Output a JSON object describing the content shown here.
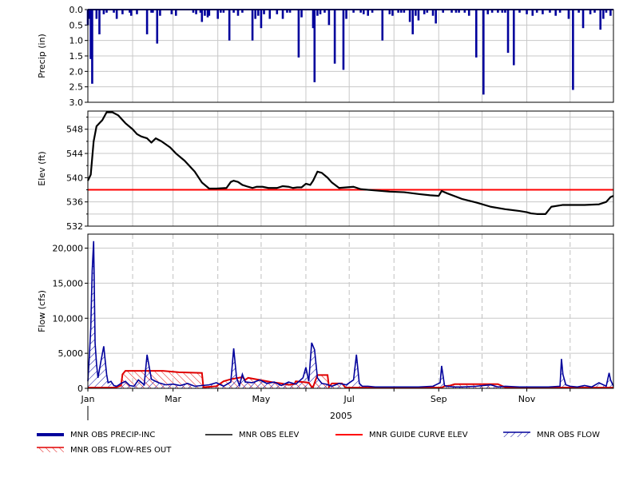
{
  "chart_data": [
    {
      "type": "bar",
      "panel": "precip",
      "ylabel": "Precip (in)",
      "ylim": [
        0,
        3.0
      ],
      "y_inverted": true,
      "yticks": [
        "0.0",
        "0.5",
        "1.0",
        "1.5",
        "2.0",
        "2.5",
        "3.0"
      ],
      "grid": true,
      "series": [
        {
          "name": "MNR OBS PRECIP-INC",
          "color": "#00009c",
          "x_day": [
            1,
            2,
            3,
            4,
            7,
            9,
            12,
            14,
            19,
            21,
            25,
            30,
            31,
            35,
            42,
            45,
            46,
            49,
            51,
            59,
            62,
            74,
            76,
            79,
            80,
            82,
            84,
            85,
            91,
            93,
            95,
            99,
            102,
            105,
            108,
            115,
            117,
            119,
            121,
            123,
            127,
            132,
            136,
            139,
            141,
            147,
            149,
            157,
            158,
            160,
            162,
            165,
            168,
            172,
            178,
            180,
            185,
            190,
            192,
            195,
            198,
            205,
            210,
            212,
            216,
            218,
            220,
            224,
            226,
            228,
            230,
            234,
            236,
            240,
            242,
            247,
            253,
            256,
            258,
            262,
            265,
            270,
            275,
            278,
            281,
            285,
            288,
            290,
            292,
            296,
            300,
            305,
            309,
            312,
            316,
            321,
            325,
            328,
            334,
            337,
            341,
            344,
            349,
            352,
            356,
            358,
            360,
            363
          ],
          "values": [
            0.5,
            0.3,
            1.6,
            2.4,
            0.3,
            0.8,
            0.15,
            0.1,
            0.1,
            0.3,
            0.15,
            0.1,
            0.2,
            0.15,
            0.8,
            0.1,
            0.1,
            1.1,
            0.2,
            0.15,
            0.2,
            0.1,
            0.15,
            0.1,
            0.4,
            0.2,
            0.25,
            0.2,
            0.3,
            0.1,
            0.1,
            1.0,
            0.1,
            0.2,
            0.1,
            1.0,
            0.3,
            0.2,
            0.6,
            0.15,
            0.3,
            0.15,
            0.3,
            0.1,
            0.1,
            1.55,
            0.25,
            0.6,
            2.35,
            0.2,
            0.15,
            0.1,
            0.5,
            1.75,
            1.95,
            0.3,
            0.1,
            0.1,
            0.15,
            0.2,
            0.1,
            1.0,
            0.15,
            0.2,
            0.1,
            0.1,
            0.1,
            0.4,
            0.8,
            0.2,
            0.35,
            0.15,
            0.1,
            0.2,
            0.45,
            0.1,
            0.1,
            0.1,
            0.1,
            0.1,
            0.2,
            1.55,
            2.75,
            0.15,
            0.1,
            0.1,
            0.1,
            0.1,
            1.4,
            1.8,
            0.1,
            0.15,
            0.2,
            0.1,
            0.15,
            0.1,
            0.2,
            0.1,
            0.3,
            2.6,
            0.1,
            0.6,
            0.15,
            0.1,
            0.65,
            0.3,
            0.1,
            0.2
          ]
        }
      ]
    },
    {
      "type": "line",
      "panel": "elev",
      "ylabel": "Elev (ft)",
      "ylim": [
        532,
        551
      ],
      "yticks": [
        "532",
        "536",
        "540",
        "544",
        "548"
      ],
      "grid": true,
      "series": [
        {
          "name": "MNR OBS ELEV",
          "color": "#000000",
          "x_day": [
            1,
            3,
            5,
            7,
            9,
            11,
            14,
            18,
            22,
            27,
            32,
            35,
            38,
            42,
            45,
            48,
            52,
            58,
            62,
            68,
            75,
            80,
            85,
            90,
            97,
            100,
            102,
            105,
            108,
            112,
            115,
            118,
            122,
            126,
            132,
            136,
            140,
            143,
            146,
            149,
            152,
            155,
            157,
            160,
            163,
            167,
            170,
            175,
            180,
            185,
            190,
            200,
            210,
            220,
            230,
            238,
            244,
            246,
            250,
            260,
            270,
            280,
            290,
            300,
            305,
            308,
            312,
            318,
            322,
            330,
            345,
            355,
            360,
            363,
            365
          ],
          "values": [
            539.5,
            540.5,
            546,
            548.5,
            549,
            549.5,
            550.8,
            550.8,
            550.3,
            549,
            548,
            547.2,
            546.8,
            546.5,
            545.8,
            546.5,
            546,
            545,
            544,
            542.8,
            541,
            539.2,
            538.2,
            538.2,
            538.3,
            539.3,
            539.5,
            539.3,
            538.8,
            538.5,
            538.3,
            538.5,
            538.5,
            538.3,
            538.3,
            538.6,
            538.5,
            538.3,
            538.4,
            538.4,
            539,
            538.8,
            539.5,
            541,
            540.8,
            540,
            539.2,
            538.3,
            538.4,
            538.5,
            538.1,
            537.9,
            537.7,
            537.6,
            537.3,
            537.1,
            537,
            537.8,
            537.4,
            536.5,
            535.9,
            535.2,
            534.8,
            534.5,
            534.3,
            534.1,
            534,
            534,
            535.2,
            535.5,
            535.5,
            535.6,
            536,
            536.8,
            537
          ]
        },
        {
          "name": "MNR GUIDE CURVE ELEV",
          "color": "#ff0000",
          "x_day": [
            1,
            365
          ],
          "values": [
            538,
            538
          ]
        }
      ]
    },
    {
      "type": "line",
      "panel": "flow",
      "ylabel": "Flow (cfs)",
      "ylim": [
        0,
        22000
      ],
      "yticks": [
        "0",
        "5,000",
        "10,000",
        "15,000",
        "20,000"
      ],
      "x_tick_labels": [
        "Jan",
        "Mar",
        "May",
        "Jul",
        "Sep",
        "Nov"
      ],
      "x_year_label": "2005",
      "grid": true,
      "series": [
        {
          "name": "MNR OBS FLOW",
          "color": "#00009c",
          "x_day": [
            1,
            2,
            3,
            4,
            5,
            6,
            7,
            8,
            10,
            12,
            14,
            15,
            17,
            19,
            21,
            24,
            27,
            30,
            33,
            36,
            40,
            42,
            45,
            50,
            55,
            60,
            65,
            70,
            75,
            80,
            85,
            90,
            95,
            100,
            102,
            104,
            106,
            108,
            110,
            115,
            120,
            125,
            130,
            135,
            140,
            145,
            150,
            152,
            154,
            156,
            158,
            160,
            163,
            166,
            170,
            175,
            180,
            185,
            187,
            189,
            191,
            195,
            200,
            210,
            220,
            230,
            240,
            245,
            246,
            247,
            248,
            250,
            255,
            260,
            270,
            280,
            285,
            290,
            300,
            310,
            320,
            328,
            329,
            330,
            332,
            335,
            340,
            345,
            350,
            355,
            360,
            362,
            363,
            365
          ],
          "values": [
            1000,
            4500,
            8500,
            16800,
            21000,
            6500,
            3500,
            1500,
            3800,
            6000,
            2000,
            800,
            1000,
            400,
            300,
            700,
            1000,
            400,
            300,
            1200,
            500,
            4800,
            1300,
            800,
            500,
            600,
            400,
            700,
            300,
            400,
            500,
            800,
            300,
            900,
            5700,
            1500,
            400,
            2000,
            900,
            800,
            1200,
            700,
            900,
            400,
            900,
            600,
            1500,
            3000,
            1000,
            6500,
            5500,
            1500,
            700,
            600,
            300,
            700,
            500,
            1200,
            4800,
            700,
            300,
            300,
            200,
            200,
            200,
            200,
            300,
            800,
            3200,
            1800,
            400,
            300,
            200,
            200,
            300,
            500,
            200,
            300,
            200,
            200,
            200,
            300,
            4200,
            2000,
            500,
            300,
            200,
            400,
            200,
            800,
            300,
            2200,
            1200,
            300
          ]
        },
        {
          "name": "MNR OBS FLOW-RES OUT",
          "color": "#e00000",
          "x_day": [
            1,
            20,
            24,
            25,
            27,
            53,
            64,
            80,
            81,
            90,
            95,
            100,
            108,
            110,
            112,
            128,
            135,
            140,
            144,
            145,
            150,
            154,
            156,
            157,
            160,
            167,
            168,
            170,
            177,
            179,
            180,
            200,
            230,
            240,
            246,
            248,
            252,
            255,
            260,
            270,
            280,
            285,
            290,
            300,
            305,
            330,
            335,
            360,
            365
          ],
          "values": [
            100,
            100,
            400,
            2000,
            2500,
            2500,
            2300,
            2200,
            150,
            300,
            1000,
            1300,
            1600,
            1200,
            1500,
            900,
            700,
            500,
            600,
            1000,
            900,
            800,
            200,
            200,
            1900,
            1900,
            200,
            700,
            700,
            200,
            100,
            100,
            100,
            100,
            100,
            300,
            400,
            600,
            600,
            600,
            600,
            600,
            150,
            150,
            100,
            100,
            100,
            100,
            100
          ]
        }
      ]
    }
  ],
  "legend": {
    "items": [
      {
        "label": "MNR OBS PRECIP-INC",
        "color": "#00009c",
        "style": "thick-line"
      },
      {
        "label": "MNR OBS ELEV",
        "color": "#000000",
        "style": "line"
      },
      {
        "label": "MNR GUIDE CURVE ELEV",
        "color": "#ff0000",
        "style": "line"
      },
      {
        "label": "MNR OBS FLOW",
        "color": "#00009c",
        "style": "hatch"
      },
      {
        "label": "MNR OBS FLOW-RES OUT",
        "color": "#e00000",
        "style": "hatch"
      }
    ]
  }
}
